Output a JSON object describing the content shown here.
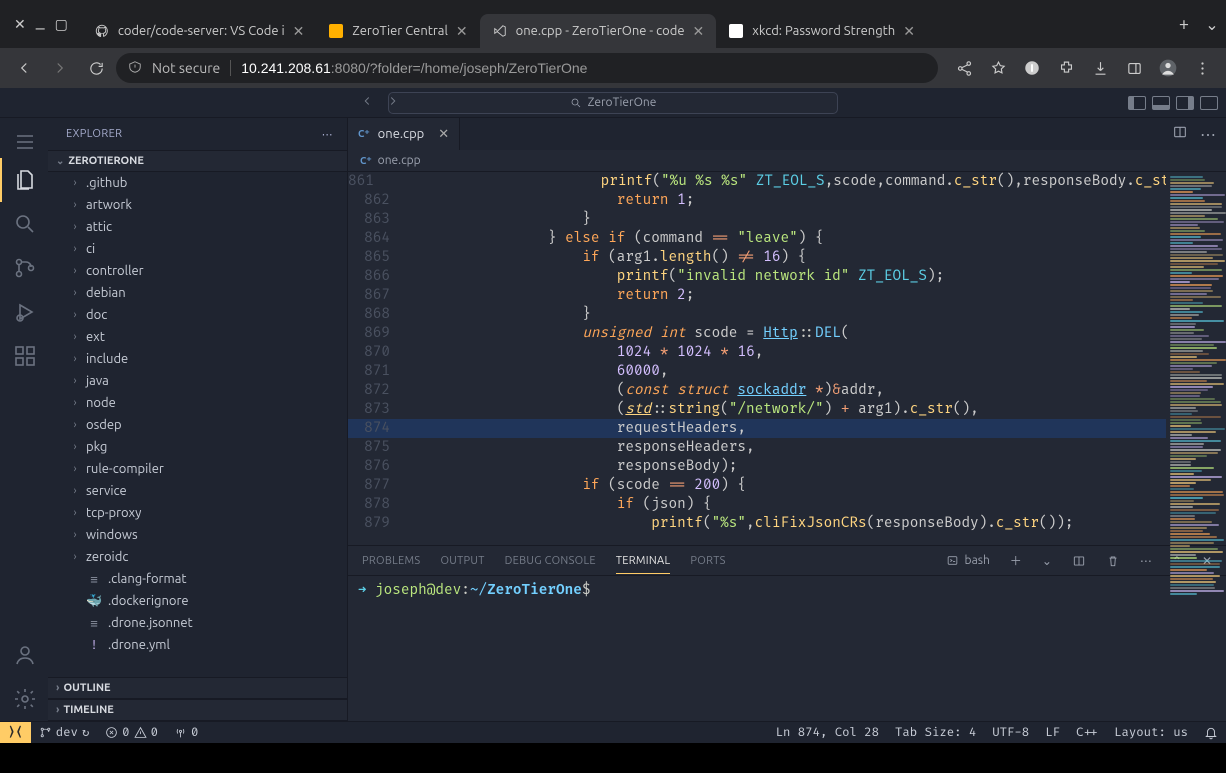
{
  "browser": {
    "tabs": [
      {
        "title": "coder/code-server: VS Code i",
        "favicon": "github"
      },
      {
        "title": "ZeroTier Central",
        "favicon": "zt"
      },
      {
        "title": "one.cpp - ZeroTierOne - code",
        "favicon": "vscode",
        "active": true
      },
      {
        "title": "xkcd: Password Strength",
        "favicon": "xkcd"
      }
    ],
    "security_label": "Not secure",
    "url_host": "10.241.208.61",
    "url_port": ":8080",
    "url_path": "/?folder=/home/joseph/ZeroTierOne"
  },
  "vscode": {
    "search_placeholder": "ZeroTierOne",
    "explorer_label": "EXPLORER",
    "root_label": "ZEROTIERONE",
    "outline_label": "OUTLINE",
    "timeline_label": "TIMELINE",
    "tree": [
      {
        "name": ".github",
        "kind": "folder"
      },
      {
        "name": "artwork",
        "kind": "folder"
      },
      {
        "name": "attic",
        "kind": "folder"
      },
      {
        "name": "ci",
        "kind": "folder"
      },
      {
        "name": "controller",
        "kind": "folder"
      },
      {
        "name": "debian",
        "kind": "folder"
      },
      {
        "name": "doc",
        "kind": "folder"
      },
      {
        "name": "ext",
        "kind": "folder"
      },
      {
        "name": "include",
        "kind": "folder"
      },
      {
        "name": "java",
        "kind": "folder"
      },
      {
        "name": "node",
        "kind": "folder"
      },
      {
        "name": "osdep",
        "kind": "folder"
      },
      {
        "name": "pkg",
        "kind": "folder"
      },
      {
        "name": "rule-compiler",
        "kind": "folder"
      },
      {
        "name": "service",
        "kind": "folder"
      },
      {
        "name": "tcp-proxy",
        "kind": "folder"
      },
      {
        "name": "windows",
        "kind": "folder"
      },
      {
        "name": "zeroidc",
        "kind": "folder"
      },
      {
        "name": ".clang-format",
        "kind": "file",
        "icon": "≡"
      },
      {
        "name": ".dockerignore",
        "kind": "file",
        "icon": "🐳"
      },
      {
        "name": ".drone.jsonnet",
        "kind": "file",
        "icon": "≡"
      },
      {
        "name": ".drone.yml",
        "kind": "file",
        "icon": "!"
      }
    ],
    "editor": {
      "tab_label": "one.cpp",
      "breadcrumb": "one.cpp",
      "first_line_no": 861,
      "highlight_line": 874,
      "lines": [
        "                        printf(\"%u %s %s\" ZT_EOL_S,scode,command.c_str(),responseBody.c_str",
        "                        return 1;",
        "                    }",
        "                } else if (command == \"leave\") {",
        "                    if (arg1.length() != 16) {",
        "                        printf(\"invalid network id\" ZT_EOL_S);",
        "                        return 2;",
        "                    }",
        "                    unsigned int scode = Http::DEL(",
        "                        1024 * 1024 * 16,",
        "                        60000,",
        "                        (const struct sockaddr *)&addr,",
        "                        (std::string(\"/network/\") + arg1).c_str(),",
        "                        requestHeaders,",
        "                        responseHeaders,",
        "                        responseBody);",
        "                    if (scode == 200) {",
        "                        if (json) {",
        "                            printf(\"%s\",cliFixJsonCRs(responseBody).c_str());"
      ]
    },
    "panel": {
      "tabs": [
        "PROBLEMS",
        "OUTPUT",
        "DEBUG CONSOLE",
        "TERMINAL",
        "PORTS"
      ],
      "active_tab": "TERMINAL",
      "shell_label": "bash",
      "prompt_user": "joseph@dev",
      "prompt_sep": ":",
      "prompt_tilde": "~/",
      "prompt_path": "ZeroTierOne",
      "prompt_char": "$"
    },
    "status": {
      "remote_icon": "⇄",
      "branch": "dev",
      "sync_icon": "↻",
      "errors": "0",
      "warnings": "0",
      "ports": "0",
      "ln_col": "Ln 874, Col 28",
      "tab_size": "Tab Size: 4",
      "encoding": "UTF-8",
      "eol": "LF",
      "lang": "C++",
      "layout": "Layout: us"
    }
  }
}
